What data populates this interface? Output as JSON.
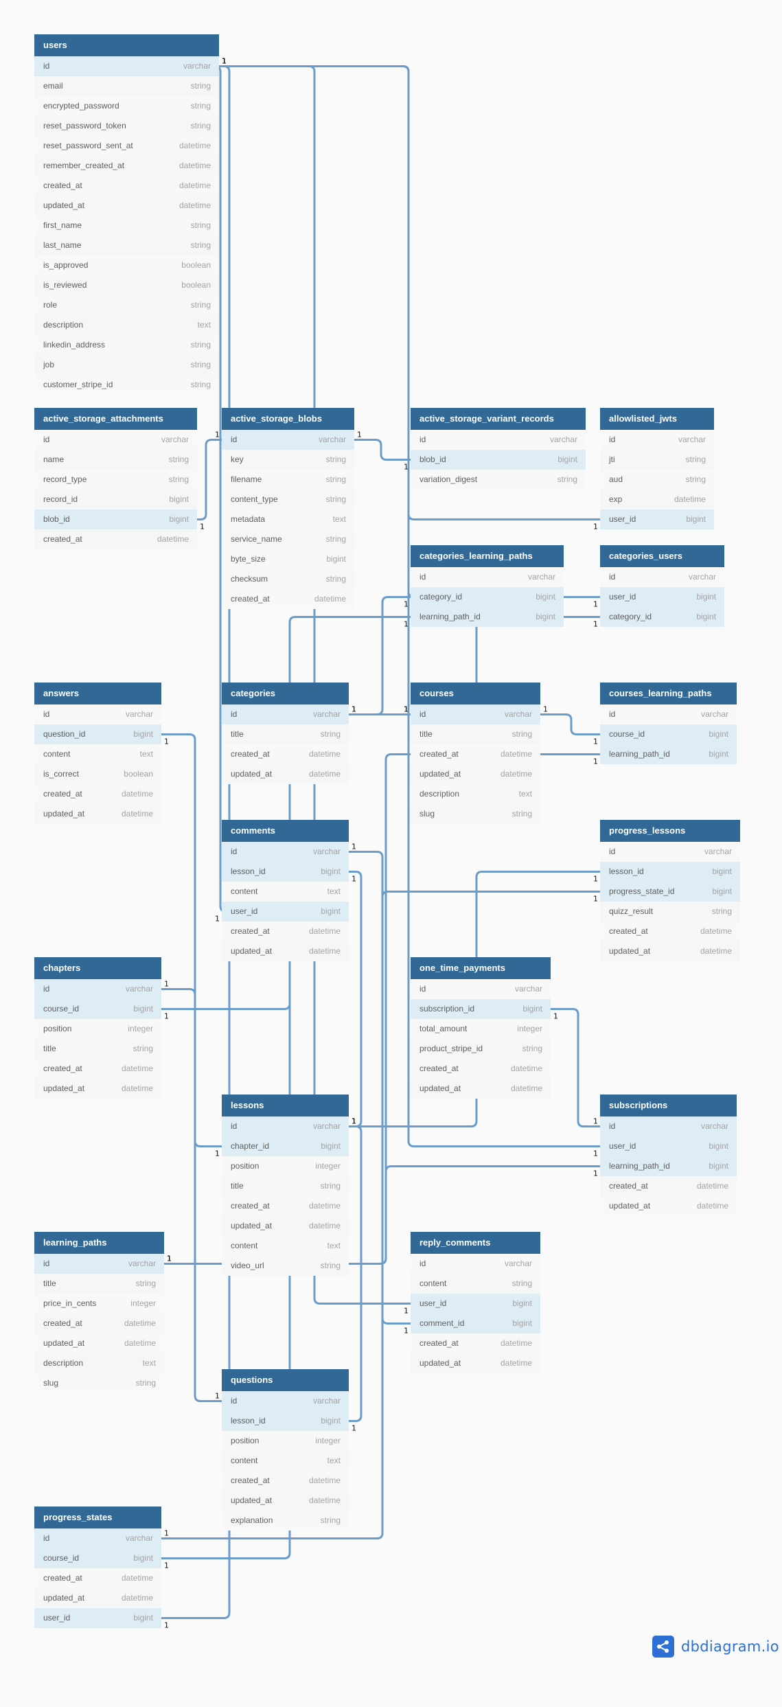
{
  "colors": {
    "header_bg": "#326895",
    "link_stroke": "#6a9ccb",
    "key_row_bg": "#deedf5",
    "row_bg": "#f6f6f6",
    "brand": "#2f6fd3"
  },
  "branding": {
    "icon": "share-nodes-icon",
    "label": "dbdiagram.io"
  },
  "tables": [
    {
      "name": "users",
      "fields": [
        {
          "name": "id",
          "type": "varchar",
          "key": true
        },
        {
          "name": "email",
          "type": "string"
        },
        {
          "name": "encrypted_password",
          "type": "string"
        },
        {
          "name": "reset_password_token",
          "type": "string"
        },
        {
          "name": "reset_password_sent_at",
          "type": "datetime"
        },
        {
          "name": "remember_created_at",
          "type": "datetime"
        },
        {
          "name": "created_at",
          "type": "datetime"
        },
        {
          "name": "updated_at",
          "type": "datetime"
        },
        {
          "name": "first_name",
          "type": "string"
        },
        {
          "name": "last_name",
          "type": "string"
        },
        {
          "name": "is_approved",
          "type": "boolean"
        },
        {
          "name": "is_reviewed",
          "type": "boolean"
        },
        {
          "name": "role",
          "type": "string"
        },
        {
          "name": "description",
          "type": "text"
        },
        {
          "name": "linkedin_address",
          "type": "string"
        },
        {
          "name": "job",
          "type": "string"
        },
        {
          "name": "customer_stripe_id",
          "type": "string"
        }
      ]
    },
    {
      "name": "active_storage_attachments",
      "fields": [
        {
          "name": "id",
          "type": "varchar"
        },
        {
          "name": "name",
          "type": "string"
        },
        {
          "name": "record_type",
          "type": "string"
        },
        {
          "name": "record_id",
          "type": "bigint"
        },
        {
          "name": "blob_id",
          "type": "bigint",
          "key": true
        },
        {
          "name": "created_at",
          "type": "datetime"
        }
      ]
    },
    {
      "name": "active_storage_blobs",
      "fields": [
        {
          "name": "id",
          "type": "varchar",
          "key": true
        },
        {
          "name": "key",
          "type": "string"
        },
        {
          "name": "filename",
          "type": "string"
        },
        {
          "name": "content_type",
          "type": "string"
        },
        {
          "name": "metadata",
          "type": "text"
        },
        {
          "name": "service_name",
          "type": "string"
        },
        {
          "name": "byte_size",
          "type": "bigint"
        },
        {
          "name": "checksum",
          "type": "string"
        },
        {
          "name": "created_at",
          "type": "datetime"
        }
      ]
    },
    {
      "name": "active_storage_variant_records",
      "fields": [
        {
          "name": "id",
          "type": "varchar"
        },
        {
          "name": "blob_id",
          "type": "bigint",
          "key": true
        },
        {
          "name": "variation_digest",
          "type": "string"
        }
      ]
    },
    {
      "name": "allowlisted_jwts",
      "fields": [
        {
          "name": "id",
          "type": "varchar"
        },
        {
          "name": "jti",
          "type": "string"
        },
        {
          "name": "aud",
          "type": "string"
        },
        {
          "name": "exp",
          "type": "datetime"
        },
        {
          "name": "user_id",
          "type": "bigint",
          "key": true
        }
      ]
    },
    {
      "name": "categories_learning_paths",
      "fields": [
        {
          "name": "id",
          "type": "varchar"
        },
        {
          "name": "category_id",
          "type": "bigint",
          "key": true
        },
        {
          "name": "learning_path_id",
          "type": "bigint",
          "key": true
        }
      ]
    },
    {
      "name": "categories_users",
      "fields": [
        {
          "name": "id",
          "type": "varchar"
        },
        {
          "name": "user_id",
          "type": "bigint",
          "key": true
        },
        {
          "name": "category_id",
          "type": "bigint",
          "key": true
        }
      ]
    },
    {
      "name": "answers",
      "fields": [
        {
          "name": "id",
          "type": "varchar"
        },
        {
          "name": "question_id",
          "type": "bigint",
          "key": true
        },
        {
          "name": "content",
          "type": "text"
        },
        {
          "name": "is_correct",
          "type": "boolean"
        },
        {
          "name": "created_at",
          "type": "datetime"
        },
        {
          "name": "updated_at",
          "type": "datetime"
        }
      ]
    },
    {
      "name": "categories",
      "fields": [
        {
          "name": "id",
          "type": "varchar",
          "key": true
        },
        {
          "name": "title",
          "type": "string"
        },
        {
          "name": "created_at",
          "type": "datetime"
        },
        {
          "name": "updated_at",
          "type": "datetime"
        }
      ]
    },
    {
      "name": "courses",
      "fields": [
        {
          "name": "id",
          "type": "varchar",
          "key": true
        },
        {
          "name": "title",
          "type": "string"
        },
        {
          "name": "created_at",
          "type": "datetime"
        },
        {
          "name": "updated_at",
          "type": "datetime"
        },
        {
          "name": "description",
          "type": "text"
        },
        {
          "name": "slug",
          "type": "string"
        }
      ]
    },
    {
      "name": "courses_learning_paths",
      "fields": [
        {
          "name": "id",
          "type": "varchar"
        },
        {
          "name": "course_id",
          "type": "bigint",
          "key": true
        },
        {
          "name": "learning_path_id",
          "type": "bigint",
          "key": true
        }
      ]
    },
    {
      "name": "comments",
      "fields": [
        {
          "name": "id",
          "type": "varchar",
          "key": true
        },
        {
          "name": "lesson_id",
          "type": "bigint",
          "key": true
        },
        {
          "name": "content",
          "type": "text"
        },
        {
          "name": "user_id",
          "type": "bigint",
          "key": true
        },
        {
          "name": "created_at",
          "type": "datetime"
        },
        {
          "name": "updated_at",
          "type": "datetime"
        }
      ]
    },
    {
      "name": "progress_lessons",
      "fields": [
        {
          "name": "id",
          "type": "varchar"
        },
        {
          "name": "lesson_id",
          "type": "bigint",
          "key": true
        },
        {
          "name": "progress_state_id",
          "type": "bigint",
          "key": true
        },
        {
          "name": "quizz_result",
          "type": "string"
        },
        {
          "name": "created_at",
          "type": "datetime"
        },
        {
          "name": "updated_at",
          "type": "datetime"
        }
      ]
    },
    {
      "name": "chapters",
      "fields": [
        {
          "name": "id",
          "type": "varchar",
          "key": true
        },
        {
          "name": "course_id",
          "type": "bigint",
          "key": true
        },
        {
          "name": "position",
          "type": "integer"
        },
        {
          "name": "title",
          "type": "string"
        },
        {
          "name": "created_at",
          "type": "datetime"
        },
        {
          "name": "updated_at",
          "type": "datetime"
        }
      ]
    },
    {
      "name": "one_time_payments",
      "fields": [
        {
          "name": "id",
          "type": "varchar"
        },
        {
          "name": "subscription_id",
          "type": "bigint",
          "key": true
        },
        {
          "name": "total_amount",
          "type": "integer"
        },
        {
          "name": "product_stripe_id",
          "type": "string"
        },
        {
          "name": "created_at",
          "type": "datetime"
        },
        {
          "name": "updated_at",
          "type": "datetime"
        }
      ]
    },
    {
      "name": "lessons",
      "fields": [
        {
          "name": "id",
          "type": "varchar",
          "key": true
        },
        {
          "name": "chapter_id",
          "type": "bigint",
          "key": true
        },
        {
          "name": "position",
          "type": "integer"
        },
        {
          "name": "title",
          "type": "string"
        },
        {
          "name": "created_at",
          "type": "datetime"
        },
        {
          "name": "updated_at",
          "type": "datetime"
        },
        {
          "name": "content",
          "type": "text"
        },
        {
          "name": "video_url",
          "type": "string"
        }
      ]
    },
    {
      "name": "subscriptions",
      "fields": [
        {
          "name": "id",
          "type": "varchar",
          "key": true
        },
        {
          "name": "user_id",
          "type": "bigint",
          "key": true
        },
        {
          "name": "learning_path_id",
          "type": "bigint",
          "key": true
        },
        {
          "name": "created_at",
          "type": "datetime"
        },
        {
          "name": "updated_at",
          "type": "datetime"
        }
      ]
    },
    {
      "name": "learning_paths",
      "fields": [
        {
          "name": "id",
          "type": "varchar",
          "key": true
        },
        {
          "name": "title",
          "type": "string"
        },
        {
          "name": "price_in_cents",
          "type": "integer"
        },
        {
          "name": "created_at",
          "type": "datetime"
        },
        {
          "name": "updated_at",
          "type": "datetime"
        },
        {
          "name": "description",
          "type": "text"
        },
        {
          "name": "slug",
          "type": "string"
        }
      ]
    },
    {
      "name": "reply_comments",
      "fields": [
        {
          "name": "id",
          "type": "varchar"
        },
        {
          "name": "content",
          "type": "string"
        },
        {
          "name": "user_id",
          "type": "bigint",
          "key": true
        },
        {
          "name": "comment_id",
          "type": "bigint",
          "key": true
        },
        {
          "name": "created_at",
          "type": "datetime"
        },
        {
          "name": "updated_at",
          "type": "datetime"
        }
      ]
    },
    {
      "name": "questions",
      "fields": [
        {
          "name": "id",
          "type": "varchar",
          "key": true
        },
        {
          "name": "lesson_id",
          "type": "bigint",
          "key": true
        },
        {
          "name": "position",
          "type": "integer"
        },
        {
          "name": "content",
          "type": "text"
        },
        {
          "name": "created_at",
          "type": "datetime"
        },
        {
          "name": "updated_at",
          "type": "datetime"
        },
        {
          "name": "explanation",
          "type": "string"
        }
      ]
    },
    {
      "name": "progress_states",
      "fields": [
        {
          "name": "id",
          "type": "varchar",
          "key": true
        },
        {
          "name": "course_id",
          "type": "bigint",
          "key": true
        },
        {
          "name": "created_at",
          "type": "datetime"
        },
        {
          "name": "updated_at",
          "type": "datetime"
        },
        {
          "name": "user_id",
          "type": "bigint",
          "key": true
        }
      ]
    }
  ],
  "relationships": [
    {
      "from": "users.id",
      "to": "allowlisted_jwts.user_id",
      "cardinality": [
        "1",
        "1"
      ]
    },
    {
      "from": "users.id",
      "to": "categories_users.user_id",
      "cardinality": [
        "1",
        "1"
      ]
    },
    {
      "from": "users.id",
      "to": "comments.user_id",
      "cardinality": [
        "1",
        "1"
      ]
    },
    {
      "from": "users.id",
      "to": "progress_states.user_id",
      "cardinality": [
        "1",
        "1"
      ]
    },
    {
      "from": "users.id",
      "to": "subscriptions.user_id",
      "cardinality": [
        "1",
        "1"
      ]
    },
    {
      "from": "users.id",
      "to": "reply_comments.user_id",
      "cardinality": [
        "1",
        "1"
      ]
    },
    {
      "from": "active_storage_blobs.id",
      "to": "active_storage_attachments.blob_id",
      "cardinality": [
        "1",
        "1"
      ]
    },
    {
      "from": "active_storage_blobs.id",
      "to": "active_storage_variant_records.blob_id",
      "cardinality": [
        "1",
        "1"
      ]
    },
    {
      "from": "categories.id",
      "to": "categories_learning_paths.category_id",
      "cardinality": [
        "1",
        "1"
      ]
    },
    {
      "from": "categories.id",
      "to": "categories_users.category_id",
      "cardinality": [
        "1",
        "1"
      ]
    },
    {
      "from": "learning_paths.id",
      "to": "categories_learning_paths.learning_path_id",
      "cardinality": [
        "1",
        "1"
      ]
    },
    {
      "from": "learning_paths.id",
      "to": "courses_learning_paths.learning_path_id",
      "cardinality": [
        "1",
        "1"
      ]
    },
    {
      "from": "learning_paths.id",
      "to": "subscriptions.learning_path_id",
      "cardinality": [
        "1",
        "1"
      ]
    },
    {
      "from": "courses.id",
      "to": "courses_learning_paths.course_id",
      "cardinality": [
        "1",
        "1"
      ]
    },
    {
      "from": "courses.id",
      "to": "chapters.course_id",
      "cardinality": [
        "1",
        "1"
      ]
    },
    {
      "from": "courses.id",
      "to": "progress_states.course_id",
      "cardinality": [
        "1",
        "1"
      ]
    },
    {
      "from": "questions.id",
      "to": "answers.question_id",
      "cardinality": [
        "1",
        "1"
      ]
    },
    {
      "from": "chapters.id",
      "to": "lessons.chapter_id",
      "cardinality": [
        "1",
        "1"
      ]
    },
    {
      "from": "lessons.id",
      "to": "comments.lesson_id",
      "cardinality": [
        "1",
        "1"
      ]
    },
    {
      "from": "lessons.id",
      "to": "questions.lesson_id",
      "cardinality": [
        "1",
        "1"
      ]
    },
    {
      "from": "lessons.id",
      "to": "progress_lessons.lesson_id",
      "cardinality": [
        "1",
        "1"
      ]
    },
    {
      "from": "progress_states.id",
      "to": "progress_lessons.progress_state_id",
      "cardinality": [
        "1",
        "1"
      ]
    },
    {
      "from": "subscriptions.id",
      "to": "one_time_payments.subscription_id",
      "cardinality": [
        "1",
        "1"
      ]
    },
    {
      "from": "comments.id",
      "to": "reply_comments.comment_id",
      "cardinality": [
        "1",
        "1"
      ]
    }
  ]
}
